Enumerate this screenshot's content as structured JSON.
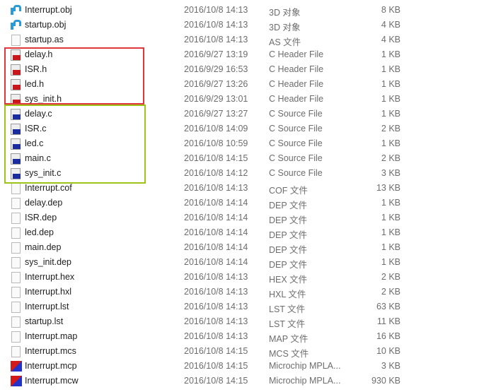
{
  "colors": {
    "header_box": "#e0363d",
    "source_box": "#9ec31a"
  },
  "files": [
    {
      "name": "Interrupt.obj",
      "date": "2016/10/8 14:13",
      "type": "3D 对象",
      "size": "8 KB",
      "icon": "obj"
    },
    {
      "name": "startup.obj",
      "date": "2016/10/8 14:13",
      "type": "3D 对象",
      "size": "4 KB",
      "icon": "obj"
    },
    {
      "name": "startup.as",
      "date": "2016/10/8 14:13",
      "type": "AS 文件",
      "size": "4 KB",
      "icon": "generic"
    },
    {
      "name": "delay.h",
      "date": "2016/9/27 13:19",
      "type": "C Header File",
      "size": "1 KB",
      "icon": "h"
    },
    {
      "name": "ISR.h",
      "date": "2016/9/29 16:53",
      "type": "C Header File",
      "size": "1 KB",
      "icon": "h"
    },
    {
      "name": "led.h",
      "date": "2016/9/27 13:26",
      "type": "C Header File",
      "size": "1 KB",
      "icon": "h"
    },
    {
      "name": "sys_init.h",
      "date": "2016/9/29 13:01",
      "type": "C Header File",
      "size": "1 KB",
      "icon": "h"
    },
    {
      "name": "delay.c",
      "date": "2016/9/27 13:27",
      "type": "C Source File",
      "size": "1 KB",
      "icon": "c"
    },
    {
      "name": "ISR.c",
      "date": "2016/10/8 14:09",
      "type": "C Source File",
      "size": "2 KB",
      "icon": "c"
    },
    {
      "name": "led.c",
      "date": "2016/10/8 10:59",
      "type": "C Source File",
      "size": "1 KB",
      "icon": "c"
    },
    {
      "name": "main.c",
      "date": "2016/10/8 14:15",
      "type": "C Source File",
      "size": "2 KB",
      "icon": "c"
    },
    {
      "name": "sys_init.c",
      "date": "2016/10/8 14:12",
      "type": "C Source File",
      "size": "3 KB",
      "icon": "c"
    },
    {
      "name": "Interrupt.cof",
      "date": "2016/10/8 14:13",
      "type": "COF 文件",
      "size": "13 KB",
      "icon": "generic"
    },
    {
      "name": "delay.dep",
      "date": "2016/10/8 14:14",
      "type": "DEP 文件",
      "size": "1 KB",
      "icon": "generic"
    },
    {
      "name": "ISR.dep",
      "date": "2016/10/8 14:14",
      "type": "DEP 文件",
      "size": "1 KB",
      "icon": "generic"
    },
    {
      "name": "led.dep",
      "date": "2016/10/8 14:14",
      "type": "DEP 文件",
      "size": "1 KB",
      "icon": "generic"
    },
    {
      "name": "main.dep",
      "date": "2016/10/8 14:14",
      "type": "DEP 文件",
      "size": "1 KB",
      "icon": "generic"
    },
    {
      "name": "sys_init.dep",
      "date": "2016/10/8 14:14",
      "type": "DEP 文件",
      "size": "1 KB",
      "icon": "generic"
    },
    {
      "name": "Interrupt.hex",
      "date": "2016/10/8 14:13",
      "type": "HEX 文件",
      "size": "2 KB",
      "icon": "generic"
    },
    {
      "name": "Interrupt.hxl",
      "date": "2016/10/8 14:13",
      "type": "HXL 文件",
      "size": "2 KB",
      "icon": "generic"
    },
    {
      "name": "Interrupt.lst",
      "date": "2016/10/8 14:13",
      "type": "LST 文件",
      "size": "63 KB",
      "icon": "generic"
    },
    {
      "name": "startup.lst",
      "date": "2016/10/8 14:13",
      "type": "LST 文件",
      "size": "11 KB",
      "icon": "generic"
    },
    {
      "name": "Interrupt.map",
      "date": "2016/10/8 14:13",
      "type": "MAP 文件",
      "size": "16 KB",
      "icon": "generic"
    },
    {
      "name": "Interrupt.mcs",
      "date": "2016/10/8 14:15",
      "type": "MCS 文件",
      "size": "10 KB",
      "icon": "generic"
    },
    {
      "name": "Interrupt.mcp",
      "date": "2016/10/8 14:15",
      "type": "Microchip MPLA...",
      "size": "3 KB",
      "icon": "mp"
    },
    {
      "name": "Interrupt.mcw",
      "date": "2016/10/8 14:15",
      "type": "Microchip MPLA...",
      "size": "930 KB",
      "icon": "mp"
    }
  ]
}
